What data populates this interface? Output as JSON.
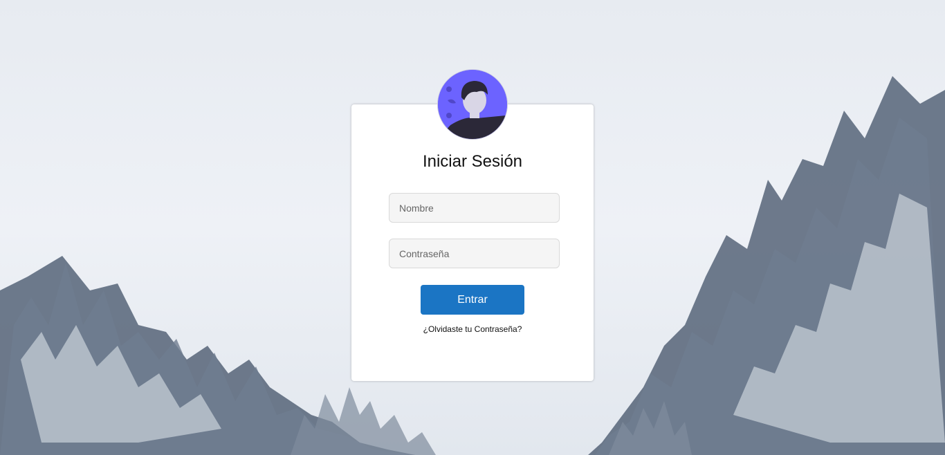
{
  "login": {
    "title": "Iniciar Sesión",
    "username_placeholder": "Nombre",
    "password_placeholder": "Contraseña",
    "submit_label": "Entrar",
    "forgot_link": "¿Olvidaste tu Contraseña?"
  },
  "colors": {
    "button": "#1b75c4",
    "avatar_bg": "#6c63ff",
    "card_bg": "#ffffff"
  },
  "icons": {
    "avatar": "user-avatar-icon"
  }
}
